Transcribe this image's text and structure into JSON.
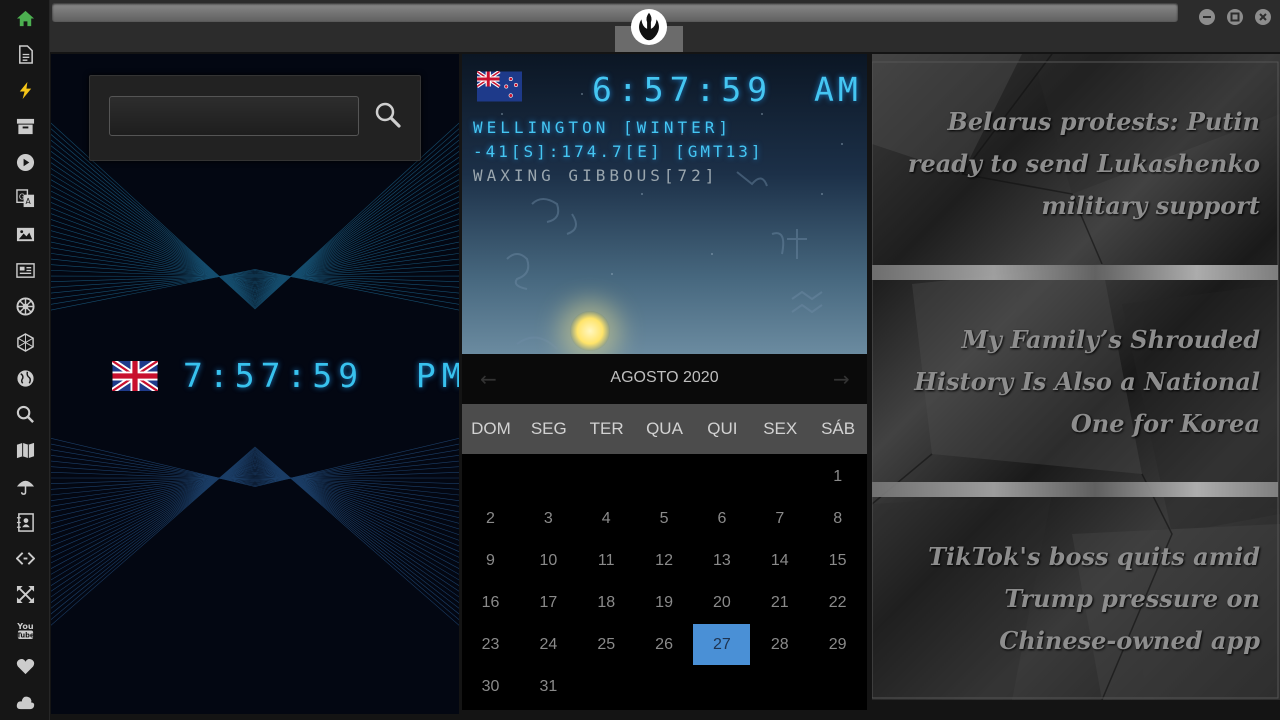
{
  "sidebar": {
    "items": [
      {
        "icon": "home-icon",
        "color": "#4caf50"
      },
      {
        "icon": "document-icon"
      },
      {
        "icon": "lightning-icon",
        "color": "#f5c518"
      },
      {
        "icon": "archive-icon"
      },
      {
        "icon": "play-icon"
      },
      {
        "icon": "translate-icon"
      },
      {
        "icon": "image-icon"
      },
      {
        "icon": "newspaper-icon"
      },
      {
        "icon": "empire-icon"
      },
      {
        "icon": "hexagon-icon"
      },
      {
        "icon": "globe-icon"
      },
      {
        "icon": "search-icon"
      },
      {
        "icon": "map-icon"
      },
      {
        "icon": "umbrella-icon"
      },
      {
        "icon": "contacts-icon"
      },
      {
        "icon": "code-icon"
      },
      {
        "icon": "expand-icon"
      },
      {
        "icon": "youtube-icon",
        "label": "You Tube"
      },
      {
        "icon": "heart-icon"
      },
      {
        "icon": "cloud-icon"
      }
    ]
  },
  "topbar": {
    "emblem": "rebel-alliance-icon",
    "window_buttons": [
      "minimize-icon",
      "maximize-icon",
      "close-icon"
    ]
  },
  "world_clock_left": {
    "search": {
      "value": "",
      "icon": "search-icon"
    },
    "flag": "united-kingdom-flag",
    "time": "7:57:59",
    "ampm": "PM"
  },
  "world_clock_right": {
    "flag": "new-zealand-flag",
    "time": "6:57:59",
    "ampm": "AM",
    "city": "WELLINGTON [WINTER]",
    "coords": "-41[S]:174.7[E] [GMT13]",
    "moon": "WAXING GIBBOUS[72]"
  },
  "calendar": {
    "title": "AGOSTO 2020",
    "prev": "←",
    "next": "→",
    "weekdays": [
      "DOM",
      "SEG",
      "TER",
      "QUA",
      "QUI",
      "SEX",
      "SÁB"
    ],
    "first_weekday": 6,
    "days_in_month": 31,
    "today": 27
  },
  "news": {
    "items": [
      "Belarus protests: Putin ready to send Lukashenko military support",
      "My Family’s Shrouded History Is Also a National One for Korea",
      "TikTok's boss quits amid Trump pressure on Chinese-owned app"
    ]
  },
  "colors": {
    "lcd": "#45c6f2",
    "today_highlight": "#4a90d6",
    "accent_green": "#4caf50"
  }
}
